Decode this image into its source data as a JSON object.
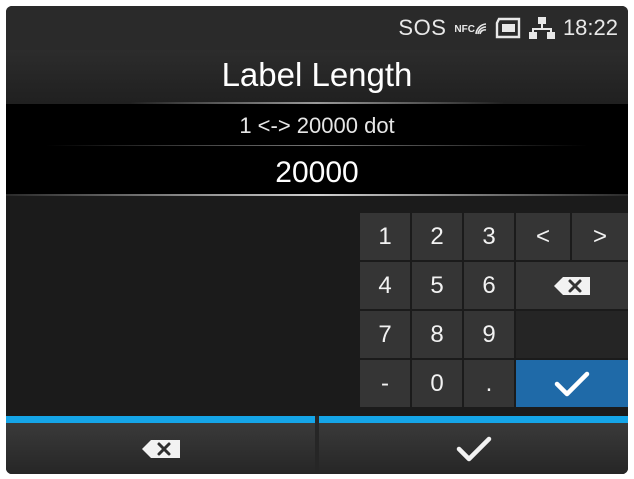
{
  "status_bar": {
    "sos": "SOS",
    "nfc": "NFC",
    "time": "18:22",
    "icons": [
      "nfc-icon",
      "sd-card-icon",
      "network-icon"
    ]
  },
  "title": "Label Length",
  "range_text": "1 <-> 20000 dot",
  "value": "20000",
  "keypad": {
    "digits": [
      "1",
      "2",
      "3",
      "4",
      "5",
      "6",
      "7",
      "8",
      "9",
      "-",
      "0",
      "."
    ],
    "cursor_left": "<",
    "cursor_right": ">",
    "backspace_icon": "backspace-icon",
    "ok_icon": "checkmark-icon"
  },
  "bottom_bar": {
    "cancel_icon": "backspace-icon",
    "confirm_icon": "checkmark-icon"
  },
  "colors": {
    "accent_blue": "#1f6aa8",
    "tab_highlight": "#15a5e8",
    "background": "#1b1b1b"
  }
}
